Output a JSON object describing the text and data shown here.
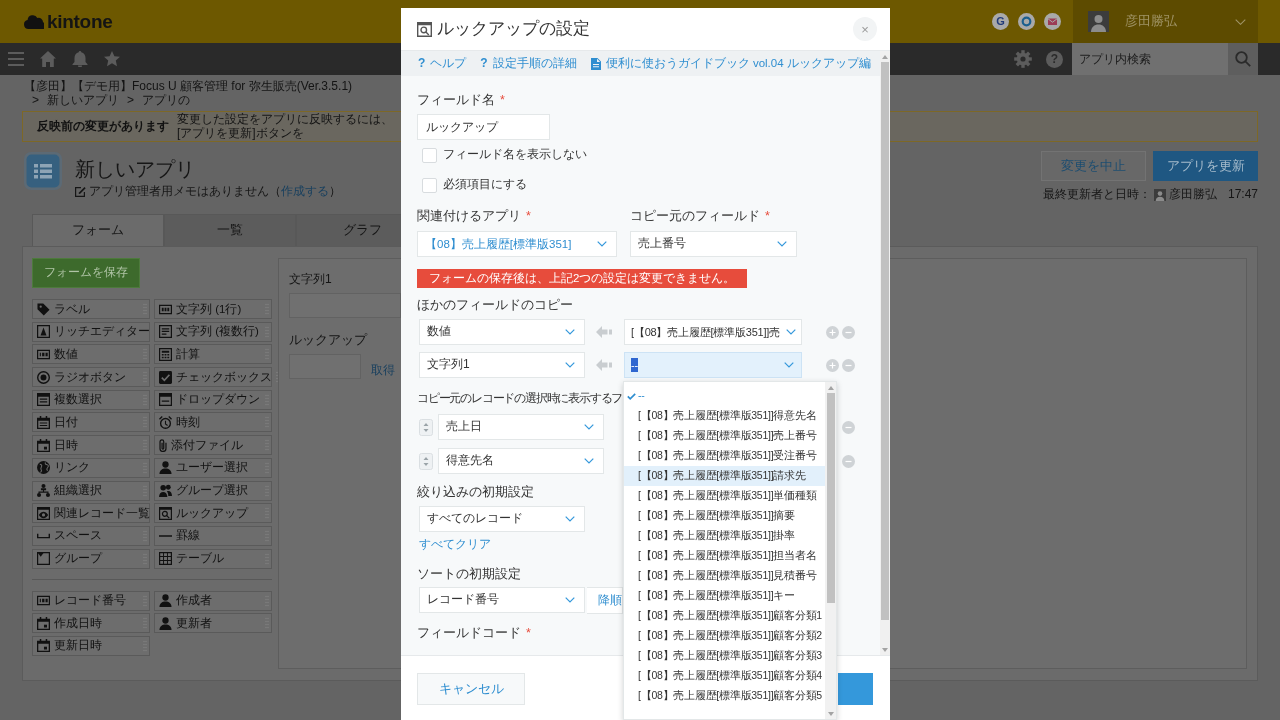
{
  "header": {
    "logo": "kintone",
    "shortcuts": [
      {
        "kind": "letter",
        "text": "G"
      },
      {
        "kind": "ring"
      },
      {
        "kind": "mail"
      }
    ],
    "user_name": "彦田勝弘"
  },
  "navbar": {
    "help": "?",
    "search": {
      "placeholder": "アプリ内検索"
    }
  },
  "breadcrumb": [
    {
      "kind": "link",
      "text": "【彦田】【デモ用】Focus U 顧客管理 for 弥生販売(Ver.3.5.1)"
    },
    {
      "kind": "separator",
      "text": ">"
    },
    {
      "kind": "link",
      "text": "新しいアプリ"
    },
    {
      "kind": "separator",
      "text": ">"
    },
    {
      "kind": "current",
      "text": "アプリの"
    }
  ],
  "notice": {
    "title": "反映前の変更があります",
    "message": "変更した設定をアプリに反映するには、[アプリを更新]ボタンを"
  },
  "app": {
    "name": "新しいアプリ",
    "memo": {
      "text": "アプリ管理者用メモはありません（",
      "link": "作成する",
      "end": "）"
    }
  },
  "actions": {
    "discard": "変更を中止",
    "update": "アプリを更新"
  },
  "last_updated": {
    "label": "最終更新者と日時：",
    "user": "彦田勝弘",
    "time": "17:47"
  },
  "tabs": [
    {
      "label": "フォーム",
      "selected": true
    },
    {
      "label": "一覧",
      "selected": false
    },
    {
      "label": "グラフ",
      "selected": false
    }
  ],
  "palette": {
    "save": "フォームを保存",
    "fields": [
      {
        "label": "ラベル",
        "kind": "label"
      },
      {
        "label": "文字列 (1行)",
        "kind": "singleline"
      },
      {
        "label": "リッチエディター",
        "kind": "richtext"
      },
      {
        "label": "文字列 (複数行)",
        "kind": "multiline"
      },
      {
        "label": "数値",
        "kind": "number"
      },
      {
        "label": "計算",
        "kind": "calc"
      },
      {
        "label": "ラジオボタン",
        "kind": "radio"
      },
      {
        "label": "チェックボックス",
        "kind": "checkbox"
      },
      {
        "label": "複数選択",
        "kind": "multiselect"
      },
      {
        "label": "ドロップダウン",
        "kind": "dropdown"
      },
      {
        "label": "日付",
        "kind": "date"
      },
      {
        "label": "時刻",
        "kind": "time"
      },
      {
        "label": "日時",
        "kind": "datetime"
      },
      {
        "label": "添付ファイル",
        "kind": "file"
      },
      {
        "label": "リンク",
        "kind": "link"
      },
      {
        "label": "ユーザー選択",
        "kind": "user"
      },
      {
        "label": "組織選択",
        "kind": "org"
      },
      {
        "label": "グループ選択",
        "kind": "group"
      },
      {
        "label": "関連レコード一覧",
        "kind": "related"
      },
      {
        "label": "ルックアップ",
        "kind": "lookup"
      },
      {
        "label": "スペース",
        "kind": "space"
      },
      {
        "label": "罫線",
        "kind": "line"
      },
      {
        "label": "グループ",
        "kind": "groupbox"
      },
      {
        "label": "テーブル",
        "kind": "table"
      }
    ],
    "system_fields": [
      {
        "label": "レコード番号",
        "kind": "recordnumber"
      },
      {
        "label": "作成者",
        "kind": "creator"
      },
      {
        "label": "作成日時",
        "kind": "created"
      },
      {
        "label": "更新者",
        "kind": "modifier"
      },
      {
        "label": "更新日時",
        "kind": "modified"
      }
    ]
  },
  "form_preview": {
    "fields": [
      {
        "kind": "text",
        "label": "文字列1"
      },
      {
        "kind": "lookup",
        "label": "ルックアップ",
        "action": "取得"
      }
    ]
  },
  "modal": {
    "title": "ルックアップの設定",
    "close": "×",
    "help_links": [
      {
        "kind": "help",
        "icon": "?",
        "label": "ヘルプ"
      },
      {
        "kind": "help",
        "icon": "?",
        "label": "設定手順の詳細"
      },
      {
        "kind": "document",
        "label": "便利に使おうガイドブック vol.04 ルックアップ編"
      }
    ],
    "field_name": {
      "label": "フィールド名",
      "mark": "*",
      "value": "ルックアップ"
    },
    "checkboxes": [
      {
        "label": "フィールド名を表示しない",
        "checked": false
      },
      {
        "label": "必須項目にする",
        "checked": false
      }
    ],
    "related_app": {
      "label": "関連付けるアプリ",
      "mark": "*",
      "value": "【08】売上履歴[標準版351]"
    },
    "source_field": {
      "label": "コピー元のフィールド",
      "mark": "*",
      "value": "売上番号"
    },
    "warning": "フォームの保存後は、上記2つの設定は変更できません。",
    "field_copies": {
      "title": "ほかのフィールドのコピー",
      "rows": [
        {
          "target": "数値",
          "source": "[【08】売上履歴[標準版351]]売",
          "focused": false
        },
        {
          "target": "文字列1",
          "source": "--",
          "focused": true
        }
      ]
    },
    "display_fields": {
      "title": "コピー元のレコードの選択時に表示するフ",
      "rows": [
        "売上日",
        "得意先名"
      ]
    },
    "filter": {
      "title": "絞り込みの初期設定",
      "value": "すべてのレコード",
      "clear": "すべてクリア"
    },
    "sort": {
      "title": "ソートの初期設定",
      "field": "レコード番号",
      "order": "降順"
    },
    "field_code": {
      "label": "フィールドコード",
      "mark": "*"
    },
    "cancel": "キャンセル",
    "dropdown": {
      "options": [
        {
          "label": "--",
          "selected": true,
          "hovered": false
        },
        {
          "label": "[【08】売上履歴[標準版351]]得意先名",
          "selected": false,
          "hovered": false
        },
        {
          "label": "[【08】売上履歴[標準版351]]売上番号",
          "selected": false,
          "hovered": false
        },
        {
          "label": "[【08】売上履歴[標準版351]]受注番号",
          "selected": false,
          "hovered": false
        },
        {
          "label": "[【08】売上履歴[標準版351]]請求先",
          "selected": false,
          "hovered": true
        },
        {
          "label": "[【08】売上履歴[標準版351]]単価種類",
          "selected": false,
          "hovered": false
        },
        {
          "label": "[【08】売上履歴[標準版351]]摘要",
          "selected": false,
          "hovered": false
        },
        {
          "label": "[【08】売上履歴[標準版351]]掛率",
          "selected": false,
          "hovered": false
        },
        {
          "label": "[【08】売上履歴[標準版351]]担当者名",
          "selected": false,
          "hovered": false
        },
        {
          "label": "[【08】売上履歴[標準版351]]見積番号",
          "selected": false,
          "hovered": false
        },
        {
          "label": "[【08】売上履歴[標準版351]]キー",
          "selected": false,
          "hovered": false
        },
        {
          "label": "[【08】売上履歴[標準版351]]顧客分類1",
          "selected": false,
          "hovered": false
        },
        {
          "label": "[【08】売上履歴[標準版351]]顧客分類2",
          "selected": false,
          "hovered": false
        },
        {
          "label": "[【08】売上履歴[標準版351]]顧客分類3",
          "selected": false,
          "hovered": false
        },
        {
          "label": "[【08】売上履歴[標準版351]]顧客分類4",
          "selected": false,
          "hovered": false
        },
        {
          "label": "[【08】売上履歴[標準版351]]顧客分類5",
          "selected": false,
          "hovered": false
        }
      ]
    }
  }
}
